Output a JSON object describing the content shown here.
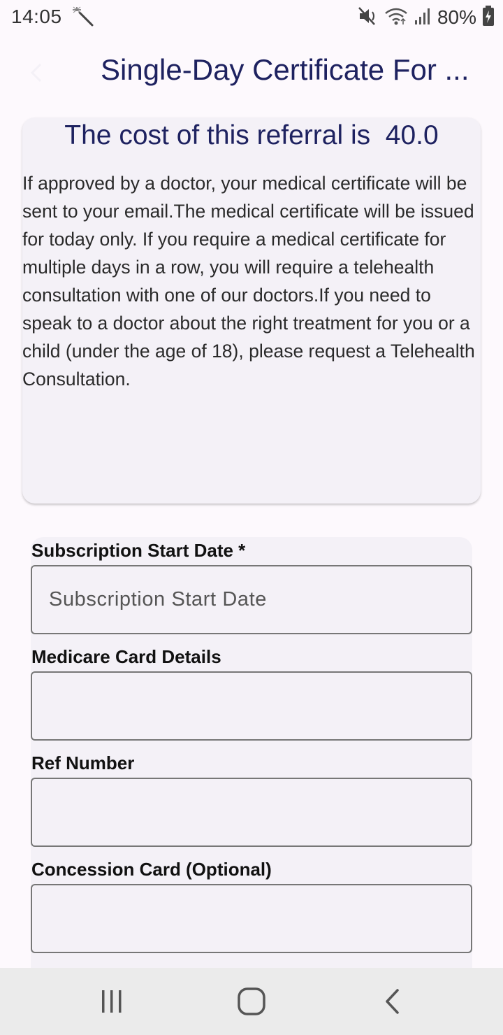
{
  "status_bar": {
    "time": "14:05",
    "battery": "80%",
    "icons": [
      "magic-wand-icon",
      "mute-icon",
      "wifi-icon",
      "signal-icon",
      "battery-charging-icon"
    ]
  },
  "app_bar": {
    "title": "Single-Day Certificate For ...",
    "back_icon": "back-arrow-icon"
  },
  "info_card": {
    "cost_text": "The cost of this referral is  40.0",
    "description": "If approved by a doctor, your medical certificate will be sent to your email.The medical certificate will be issued for today only. If you require a medical certificate for multiple days in a row, you will require a telehealth consultation with one of our doctors.If you need to speak to a doctor about the right treatment for you or a child (under the age of 18), please request a Telehealth Consultation."
  },
  "form": {
    "fields": [
      {
        "label": "Subscription Start Date *",
        "placeholder": "Subscription Start Date",
        "value": ""
      },
      {
        "label": "Medicare Card Details",
        "placeholder": "",
        "value": ""
      },
      {
        "label": "Ref Number",
        "placeholder": "",
        "value": ""
      },
      {
        "label": "Concession Card (Optional)",
        "placeholder": "",
        "value": ""
      }
    ]
  },
  "nav_bar": {
    "icons": [
      "recent-apps-icon",
      "home-icon",
      "back-icon"
    ]
  },
  "colors": {
    "accent": "#1e2260",
    "background": "#fdf9fd",
    "card": "#f4f1f7",
    "nav_bar": "#ebebeb"
  }
}
